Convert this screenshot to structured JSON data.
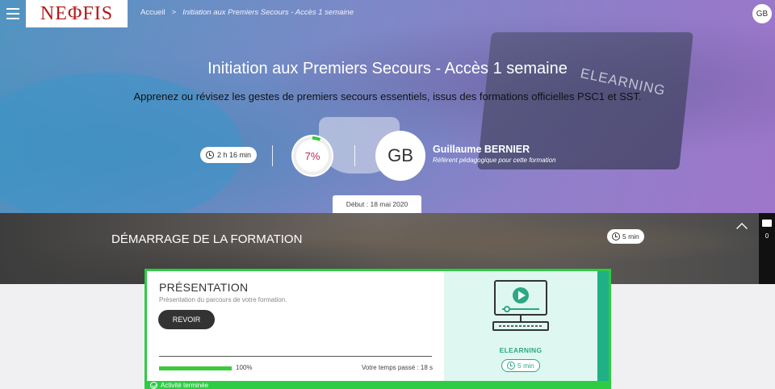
{
  "header": {
    "logo_text": "NEΦFIS",
    "breadcrumb": {
      "home": "Accueil",
      "separator": ">",
      "current": "Initiation aux Premiers Secours - Accès 1 semaine"
    },
    "user_initials": "GB"
  },
  "hero": {
    "title": "Initiation aux Premiers Secours - Accès 1 semaine",
    "subtitle": "Apprenez ou révisez les gestes de premiers secours essentiels, issus des formations officielles PSC1 et SST.",
    "duration": "2 h 16 min",
    "progress_label": "7%",
    "progress_value": 0.07,
    "trainer": {
      "initials": "GB",
      "name": "Guillaume BERNIER",
      "role": "Référent pédagogique pour cette formation"
    },
    "start_date": "Début : 18 mai 2020",
    "background_photo_text": "ELEARNING"
  },
  "section": {
    "title": "DÉMARRAGE DE LA FORMATION",
    "duration": "5 min"
  },
  "side_panel": {
    "comment_count": "0"
  },
  "activity": {
    "title": "PRÉSENTATION",
    "description": "Présentation du parcours de votre formation.",
    "button_label": "REVOIR",
    "progress_label": "100%",
    "progress_value": 1.0,
    "time_spent": "Votre temps passé : 18 s",
    "type_label": "ELEARNING",
    "duration": "5 min",
    "status": "Activité terminée"
  },
  "colors": {
    "accent_green": "#2ecb45",
    "teal": "#2aa982",
    "progress_pink": "#c0245f",
    "logo_red": "#b11a1a"
  },
  "icons": [
    "menu-icon",
    "clock-icon",
    "chevron-up-icon",
    "comment-icon",
    "computer-play-icon",
    "check-circle-icon"
  ]
}
